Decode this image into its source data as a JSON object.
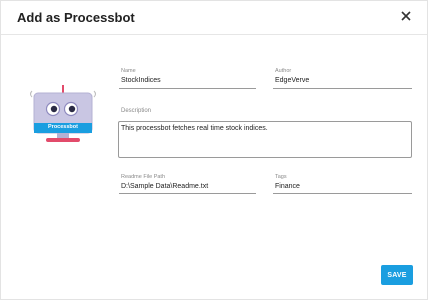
{
  "dialog": {
    "title": "Add as Processbot",
    "close_icon": "close-icon"
  },
  "bot_icon": {
    "label": "Processbot",
    "colors": {
      "screen": "#c9c6e3",
      "band": "#1a9ee0",
      "antenna_tip": "#e24b6b",
      "stand": "#e24b6b"
    }
  },
  "form": {
    "name": {
      "label": "Name",
      "value": "StockIndices"
    },
    "author": {
      "label": "Author",
      "value": "EdgeVerve"
    },
    "description": {
      "label": "Description",
      "value": "This processbot fetches real time stock indices."
    },
    "readme": {
      "label": "Readme File Path",
      "value": "D:\\Sample Data\\Readme.txt"
    },
    "tags": {
      "label": "Tags",
      "value": "Finance"
    }
  },
  "actions": {
    "save_label": "SAVE",
    "accent": "#1a9ee0"
  }
}
